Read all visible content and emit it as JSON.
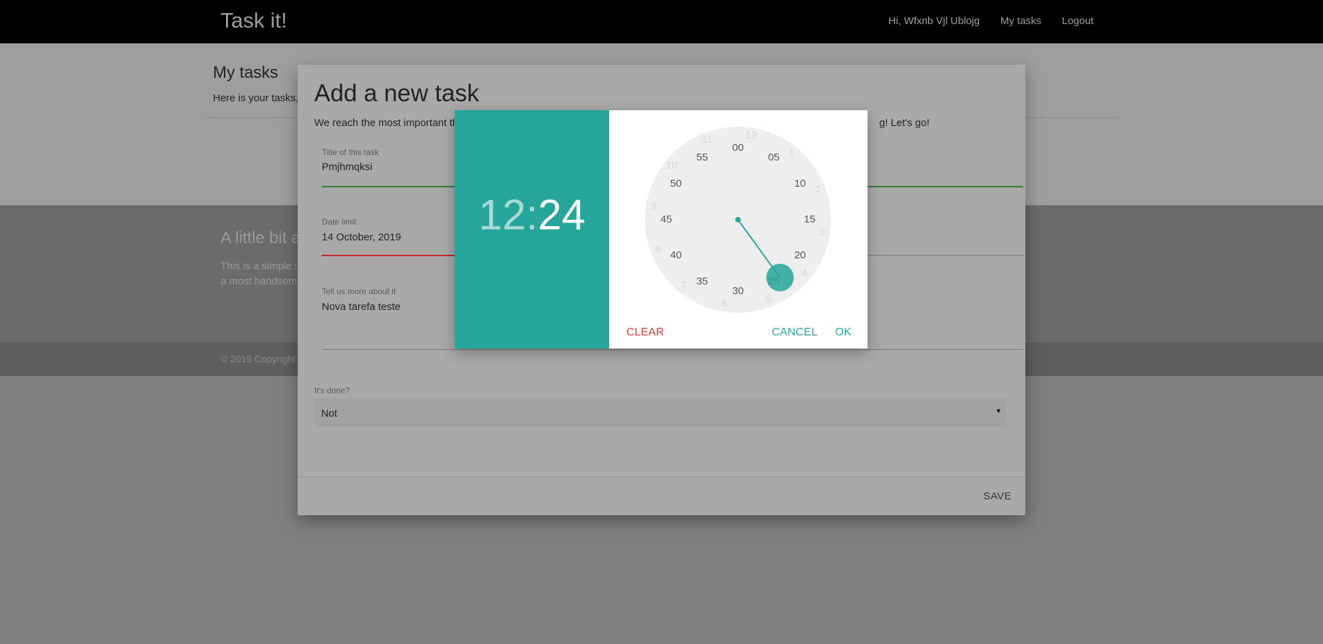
{
  "navbar": {
    "brand": "Task it!",
    "greeting": "Hi, Wfxnb Vjl Ublojg",
    "my_tasks": "My tasks",
    "logout": "Logout"
  },
  "page": {
    "title": "My tasks",
    "subtitle": "Here is your tasks,"
  },
  "footer": {
    "title": "A little bit a",
    "text_line1": "This is a simple s",
    "text_line2": "a most handsom",
    "copyright": "© 2019 Copyright"
  },
  "modal": {
    "title": "Add a new task",
    "description_start": "We reach the most important th",
    "description_end": "g! Let's go!",
    "title_field": {
      "label": "Title of this task",
      "value": "Pmjhmqksi"
    },
    "date_field": {
      "label": "Date limit",
      "value": "14 October, 2019"
    },
    "about_field": {
      "label": "Tell us more about it",
      "value": "Nova tarefa teste"
    },
    "done_field": {
      "label": "It's done?",
      "value": "Not"
    },
    "save_label": "SAVE"
  },
  "timepicker": {
    "hours": "12",
    "separator": ":",
    "minutes": "24",
    "minute_ticks": [
      "00",
      "05",
      "10",
      "15",
      "20",
      "25",
      "30",
      "35",
      "40",
      "45",
      "50",
      "55"
    ],
    "accent_color": "#26a69a",
    "clear_label": "CLEAR",
    "cancel_label": "CANCEL",
    "ok_label": "OK"
  }
}
